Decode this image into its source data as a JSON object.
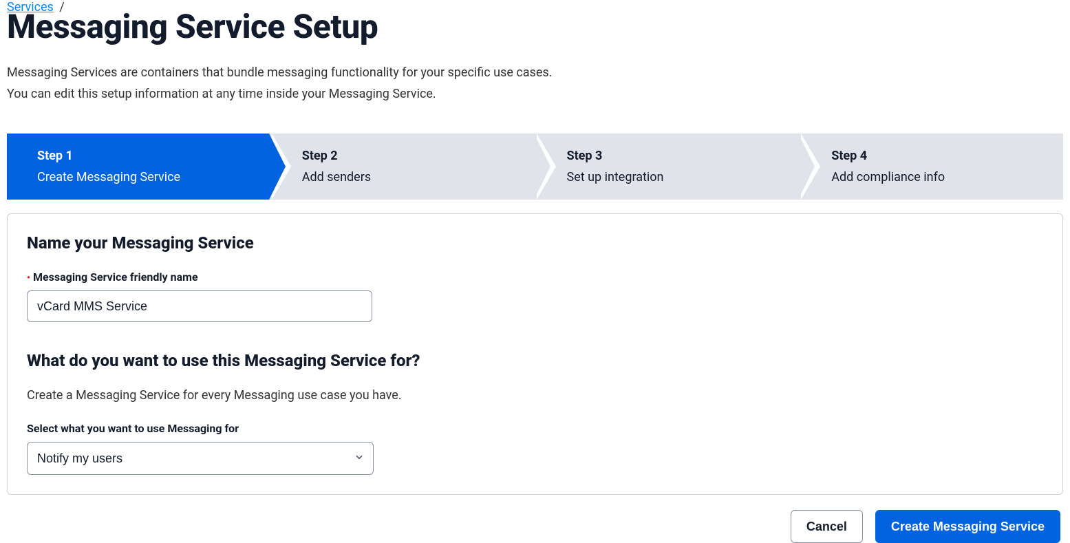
{
  "breadcrumb": {
    "parent": "Services",
    "sep": "/"
  },
  "page": {
    "title": "Messaging Service Setup",
    "intro1": "Messaging Services are containers that bundle messaging functionality for your specific use cases.",
    "intro2": "You can edit this setup information at any time inside your Messaging Service."
  },
  "stepper": {
    "steps": [
      {
        "num": "Step 1",
        "label": "Create Messaging Service",
        "active": true
      },
      {
        "num": "Step 2",
        "label": "Add senders",
        "active": false
      },
      {
        "num": "Step 3",
        "label": "Set up integration",
        "active": false
      },
      {
        "num": "Step 4",
        "label": "Add compliance info",
        "active": false
      }
    ]
  },
  "form": {
    "section1_title": "Name your Messaging Service",
    "name_label": "Messaging Service friendly name",
    "name_value": "vCard MMS Service",
    "section2_title": "What do you want to use this Messaging Service for?",
    "section2_help": "Create a Messaging Service for every Messaging use case you have.",
    "usecase_label": "Select what you want to use Messaging for",
    "usecase_value": "Notify my users"
  },
  "actions": {
    "cancel": "Cancel",
    "create": "Create Messaging Service"
  }
}
